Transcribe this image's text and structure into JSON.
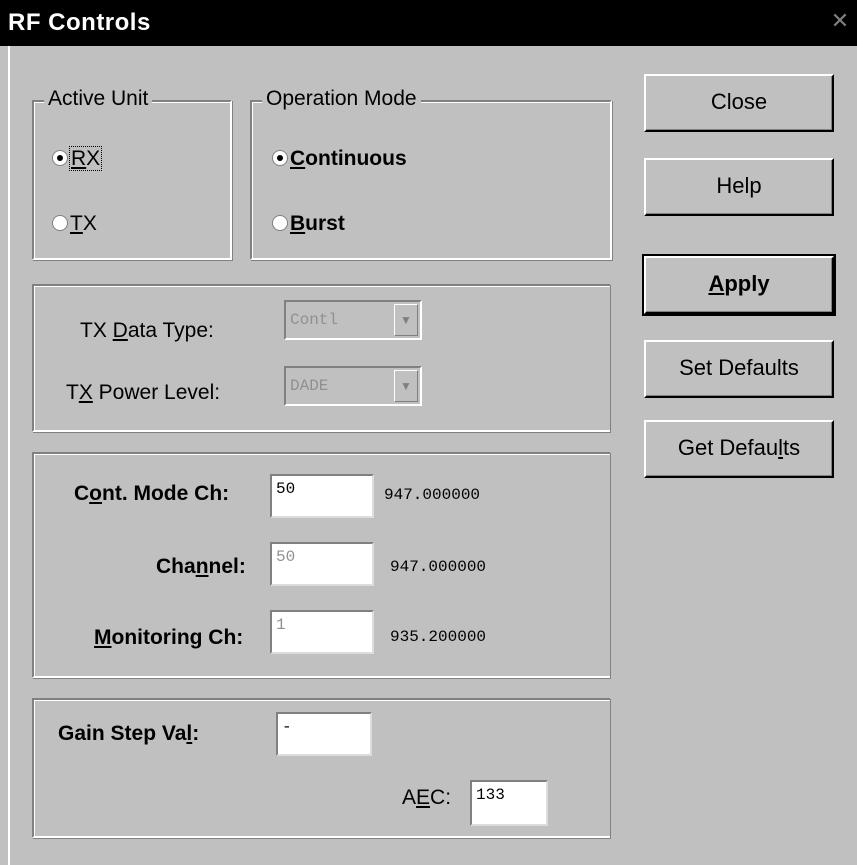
{
  "window": {
    "title": "RF Controls",
    "close_glyph": "✕"
  },
  "active_unit": {
    "legend": "Active Unit",
    "options": [
      {
        "label": "RX",
        "underline": "R",
        "rest": "X",
        "checked": true,
        "focused": true
      },
      {
        "label": "TX",
        "underline": "T",
        "rest": "X",
        "checked": false,
        "focused": false
      }
    ]
  },
  "operation_mode": {
    "legend": "Operation Mode",
    "options": [
      {
        "label": "Continuous",
        "underline": "C",
        "rest": "ontinuous",
        "checked": true
      },
      {
        "label": "Burst",
        "underline": "B",
        "rest": "urst",
        "checked": false
      }
    ]
  },
  "tx_settings": {
    "data_type_label_a": "TX ",
    "data_type_label_u": "D",
    "data_type_label_b": "ata Type:",
    "data_type_value": "Contl",
    "power_label_a": "T",
    "power_label_u": "X",
    "power_label_b": " Power Level:",
    "power_value": "DADE"
  },
  "channels": {
    "cont_label_a": "C",
    "cont_label_u": "o",
    "cont_label_b": "nt. Mode Ch:",
    "cont_value": "50",
    "cont_freq": "947.000000",
    "channel_label_a": "Cha",
    "channel_label_u": "n",
    "channel_label_b": "nel:",
    "channel_value": "50",
    "channel_freq": "947.000000",
    "monitor_label_u": "M",
    "monitor_label_b": "onitoring Ch:",
    "monitor_value": "1",
    "monitor_freq": "935.200000"
  },
  "gain": {
    "step_label_a": "Gain Step Va",
    "step_label_u": "l",
    "step_label_b": ":",
    "step_value": "-",
    "aec_label_a": "A",
    "aec_label_u": "E",
    "aec_label_b": "C:",
    "aec_value": "133"
  },
  "buttons": {
    "close": "Close",
    "help": "Help",
    "apply_u": "A",
    "apply_rest": "pply",
    "set_defaults": "Set Defaults",
    "get_defaults_a": "Get Defau",
    "get_defaults_u": "l",
    "get_defaults_b": "ts"
  }
}
